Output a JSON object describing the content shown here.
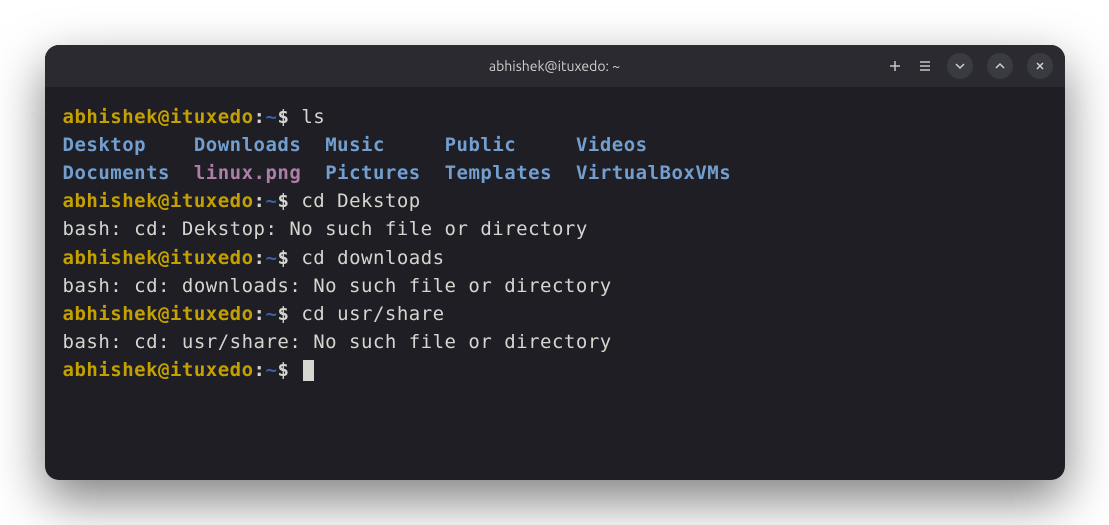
{
  "titlebar": {
    "title": "abhishek@ituxedo: ~"
  },
  "prompt": {
    "user_host": "abhishek@ituxedo",
    "separator": ":",
    "path": "~",
    "symbol": "$"
  },
  "commands": {
    "c1": "ls",
    "c2": "cd Dekstop",
    "c3": "cd downloads",
    "c4": "cd usr/share"
  },
  "ls": {
    "row1": {
      "a": "Desktop",
      "b": "Downloads",
      "c": "Music",
      "d": "Public",
      "e": "Videos"
    },
    "row2": {
      "a": "Documents",
      "b": "linux.png",
      "c": "Pictures",
      "d": "Templates",
      "e": "VirtualBoxVMs"
    }
  },
  "errors": {
    "e1": "bash: cd: Dekstop: No such file or directory",
    "e2": "bash: cd: downloads: No such file or directory",
    "e3": "bash: cd: usr/share: No such file or directory"
  }
}
